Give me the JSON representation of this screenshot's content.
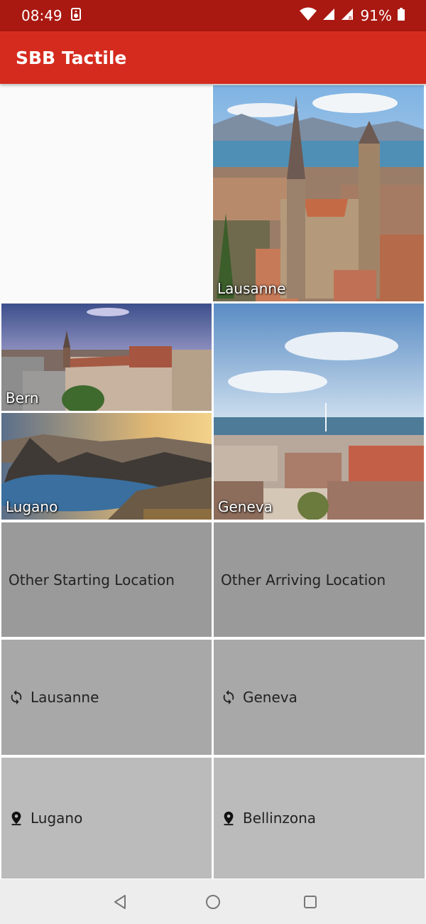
{
  "status_bar": {
    "time": "08:49",
    "battery": "91%",
    "icons": [
      "media-icon",
      "wifi-icon",
      "signal-icon",
      "signal-roaming-icon",
      "battery-icon"
    ]
  },
  "app_bar": {
    "title": "SBB Tactile"
  },
  "photo_tiles": [
    {
      "label": "Lausanne"
    },
    {
      "label": "Bern"
    },
    {
      "label": "Lugano"
    },
    {
      "label": "Geneva"
    }
  ],
  "options": {
    "other_start": "Other Starting Location",
    "other_arrive": "Other Arriving Location",
    "recent_start": {
      "label": "Lausanne",
      "icon": "sync-icon"
    },
    "recent_arrive": {
      "label": "Geneva",
      "icon": "sync-icon"
    },
    "nearby_start": {
      "label": "Lugano",
      "icon": "location-pin-icon"
    },
    "nearby_arrive": {
      "label": "Bellinzona",
      "icon": "location-pin-icon"
    }
  },
  "nav_bar": {
    "buttons": [
      "back-icon",
      "home-icon",
      "recents-icon"
    ]
  },
  "colors": {
    "status_bar": "#a91811",
    "app_bar": "#d52b1e",
    "tile_dark": "#9a9a9a",
    "tile_mid": "#a8a8a8",
    "tile_light": "#bbbbbb"
  }
}
